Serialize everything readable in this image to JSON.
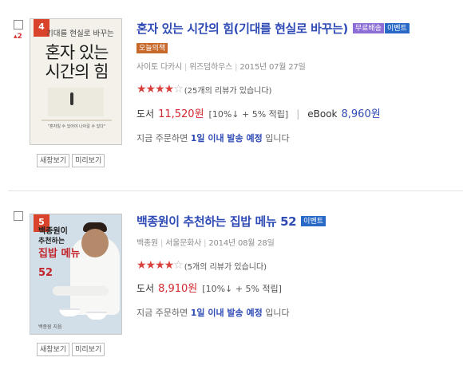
{
  "books": [
    {
      "rank": "4",
      "rank_change": "▴2",
      "title": "혼자 있는 시간의 힘(기대를 현실로 바꾸는)",
      "badges": [
        "무료배송",
        "이벤트",
        "오늘의책"
      ],
      "author": "사이토 다카시",
      "publisher": "위즈덤하우스",
      "date": "2015년 07월 27일",
      "stars": 4,
      "star_icons": "★★★★",
      "star_empty": "☆",
      "review_text": "(25개의 리뷰가 있습니다)",
      "price_label": "도서",
      "price": "11,520원",
      "discount": "[10%↓ + 5% 적립]",
      "ebook_label": "eBook",
      "ebook_price": "8,960원",
      "ship_prefix": "지금 주문하면",
      "ship_highlight": "1일 이내 발송 예정",
      "ship_suffix": "입니다",
      "preview_button": "새창보기",
      "lookinside_button": "미리보기",
      "cover": {
        "subtitle": "기대를 현실로 바꾸는",
        "title_line1": "혼자 있는",
        "title_line2": "시간의 힘",
        "quote": "\"혼자일 수 있어야 나아갈 수 있다\""
      }
    },
    {
      "rank": "5",
      "title": "백종원이 추천하는 집밥 메뉴 52",
      "badges": [
        "이벤트"
      ],
      "author": "백종원",
      "publisher": "서울문화사",
      "date": "2014년 08월 28일",
      "stars": 4,
      "star_icons": "★★★★",
      "star_empty": "☆",
      "review_text": "(5개의 리뷰가 있습니다)",
      "price_label": "도서",
      "price": "8,910원",
      "discount": "[10%↓ + 5% 적립]",
      "ship_prefix": "지금 주문하면",
      "ship_highlight": "1일 이내 발송 예정",
      "ship_suffix": "입니다",
      "preview_button": "새창보기",
      "lookinside_button": "미리보기",
      "cover": {
        "author": "백종원이",
        "line1": "추천하는",
        "line2": "집밥 메뉴",
        "line3": "52",
        "footer": "백종원 지음"
      }
    }
  ],
  "colors": {
    "title_blue": "#2f4bb6",
    "price_red": "#d2282f",
    "star_red": "#d8403c",
    "badge_free": "#8c6ed6",
    "badge_event": "#2869c7",
    "badge_today": "#c8692c"
  }
}
